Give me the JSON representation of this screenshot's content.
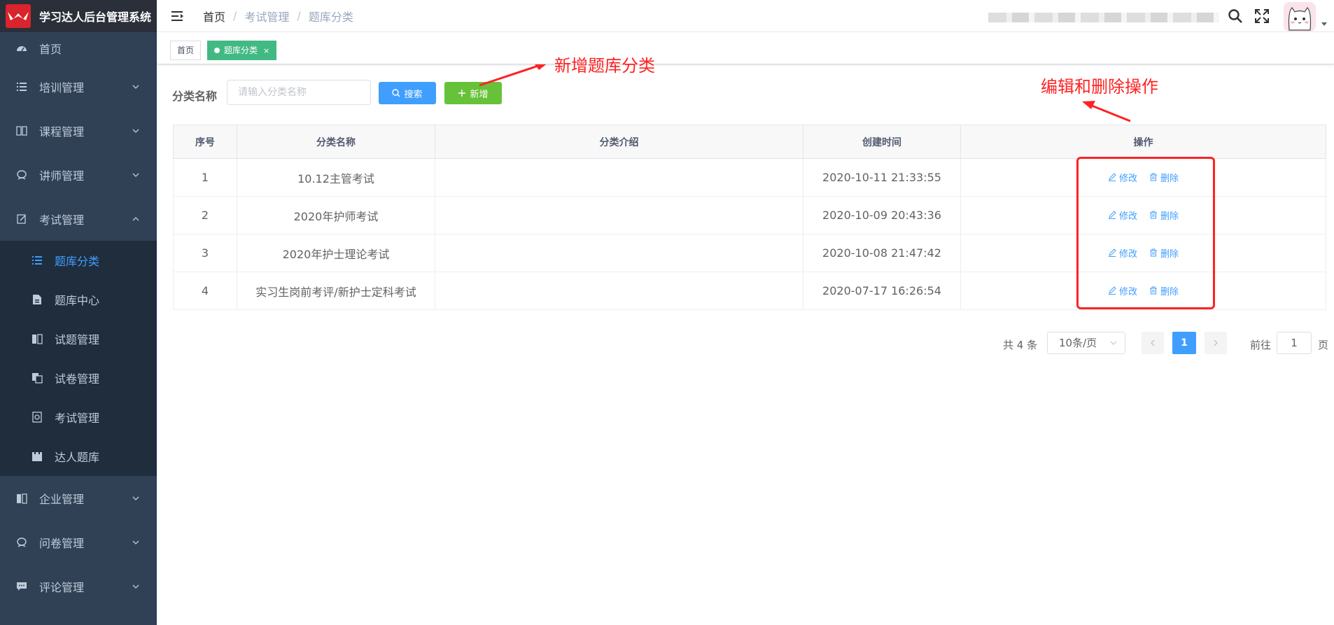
{
  "app": {
    "title": "学习达人后台管理系统"
  },
  "sidebar": {
    "items": [
      {
        "label": "首页",
        "icon": "dashboard-icon"
      },
      {
        "label": "培训管理",
        "icon": "list-icon"
      },
      {
        "label": "课程管理",
        "icon": "book-icon"
      },
      {
        "label": "讲师管理",
        "icon": "peoples-icon"
      },
      {
        "label": "考试管理",
        "icon": "edit-icon"
      }
    ],
    "sub_items": [
      {
        "label": "题库分类",
        "icon": "list-icon",
        "active": true
      },
      {
        "label": "题库中心",
        "icon": "document-icon"
      },
      {
        "label": "试题管理",
        "icon": "paper-icon"
      },
      {
        "label": "试卷管理",
        "icon": "copy-icon"
      },
      {
        "label": "考试管理",
        "icon": "exam-icon"
      },
      {
        "label": "达人题库",
        "icon": "folder-icon"
      }
    ],
    "bottom_items": [
      {
        "label": "企业管理",
        "icon": "building-icon"
      },
      {
        "label": "问卷管理",
        "icon": "peoples-icon"
      },
      {
        "label": "评论管理",
        "icon": "message-icon"
      }
    ]
  },
  "header": {
    "breadcrumb": [
      "首页",
      "考试管理",
      "题库分类"
    ],
    "separator": "/"
  },
  "tags": {
    "home": "首页",
    "current": "题库分类",
    "close": "×"
  },
  "search": {
    "label": "分类名称",
    "placeholder": "请输入分类名称",
    "search_button": "搜索",
    "add_button": "新增"
  },
  "annotations": {
    "add": "新增题库分类",
    "ops": "编辑和删除操作"
  },
  "table": {
    "columns": [
      "序号",
      "分类名称",
      "分类介绍",
      "创建时间",
      "操作"
    ],
    "rows": [
      {
        "index": "1",
        "name": "10.12主管考试",
        "intro": "",
        "created": "2020-10-11 21:33:55"
      },
      {
        "index": "2",
        "name": "2020年护师考试",
        "intro": "",
        "created": "2020-10-09 20:43:36"
      },
      {
        "index": "3",
        "name": "2020年护士理论考试",
        "intro": "",
        "created": "2020-10-08 21:47:42"
      },
      {
        "index": "4",
        "name": "实习生岗前考评/新护士定科考试",
        "intro": "",
        "created": "2020-07-17 16:26:54"
      }
    ],
    "edit_label": "修改",
    "delete_label": "删除"
  },
  "pagination": {
    "total": "共 4 条",
    "page_size": "10条/页",
    "current_page": "1",
    "goto_label": "前往",
    "goto_value": "1",
    "page_suffix": "页"
  },
  "colors": {
    "sidebar": "#304156",
    "primary": "#409eff",
    "success": "#67c23a",
    "tag": "#42b983",
    "annotation": "#ff2222"
  }
}
